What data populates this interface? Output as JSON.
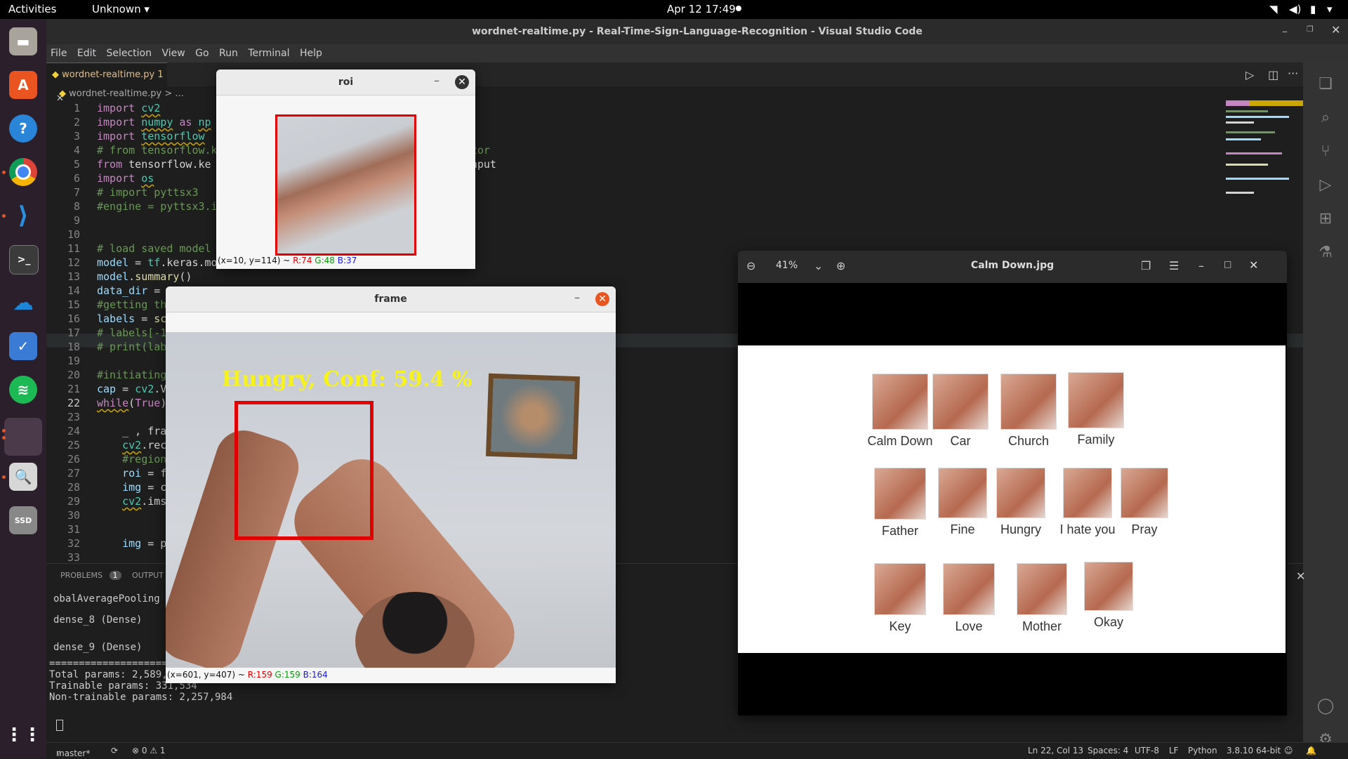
{
  "topbar": {
    "activities": "Activities",
    "app": "Unknown",
    "clock": "Apr 12  17:49"
  },
  "vscode": {
    "window_title": "wordnet-realtime.py - Real-Time-Sign-Language-Recognition - Visual Studio Code",
    "menu": [
      "File",
      "Edit",
      "Selection",
      "View",
      "Go",
      "Run",
      "Terminal",
      "Help"
    ],
    "tab_label": "wordnet-realtime.py",
    "tab_badge": "1",
    "breadcrumb": "wordnet-realtime.py > ...",
    "panel_tabs": [
      "PROBLEMS",
      "OUTPUT"
    ],
    "problems_count": "1",
    "panel_lines": {
      "l1": "obalAveragePooling",
      "l2": "dense_8 (Dense)",
      "l3": "dense_9 (Dense)",
      "sep": "========================================================================================================",
      "total": "Total params: 2,589,518",
      "trainable": "Trainable params: 331,534",
      "non_trainable": "Non-trainable params: 2,257,984"
    },
    "status": {
      "branch": "master*",
      "errors": "⊗ 0 ⚠ 1",
      "position": "Ln 22, Col 13",
      "spaces": "Spaces: 4",
      "encoding": "UTF-8",
      "eol": "LF",
      "language": "Python",
      "interpreter": "3.8.10 64-bit"
    }
  },
  "roi_window": {
    "title": "roi",
    "status_pos": "(x=10, y=114) ~ ",
    "r": "R:74",
    "g": "G:48",
    "b": "B:37"
  },
  "frame_window": {
    "title": "frame",
    "prediction": "Hungry, Conf: 59.4 %",
    "status_pos": "(x=601, y=407) ~ ",
    "r": "R:159",
    "g": "G:159",
    "b": "B:164"
  },
  "viewer": {
    "title": "Calm Down.jpg",
    "zoom": "41%",
    "signs": [
      "Calm Down",
      "Car",
      "Church",
      "Family",
      "Father",
      "Fine",
      "Hungry",
      "I hate you",
      "Pray",
      "Key",
      "Love",
      "Mother",
      "Okay"
    ]
  },
  "colors": {
    "accent": "#0078d4",
    "roi_box": "#e00000",
    "prediction_text": "#f7f219",
    "ubuntu_orange": "#e95420"
  }
}
